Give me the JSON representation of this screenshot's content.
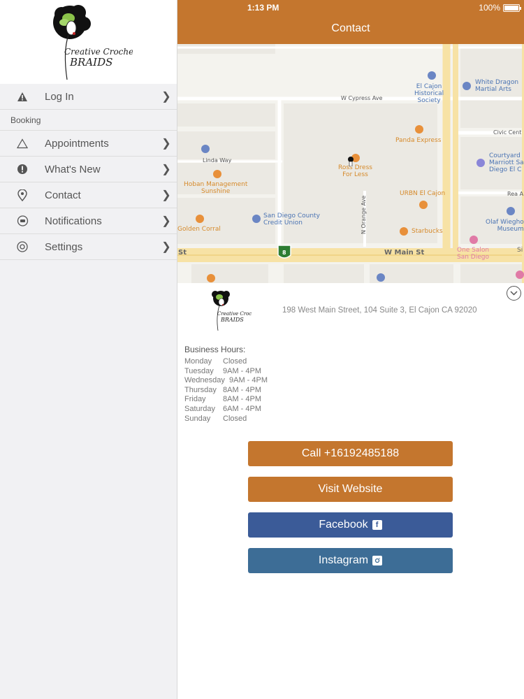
{
  "sidebar": {
    "logo_text_line1": "Creative Crochet",
    "logo_text_line2": "BRAIDS",
    "items": [
      {
        "label": "Log In",
        "icon": "warning-icon"
      },
      {
        "label": "Appointments",
        "icon": "triangle-icon"
      },
      {
        "label": "What's New",
        "icon": "exclamation-icon"
      },
      {
        "label": "Contact",
        "icon": "location-pin-icon"
      },
      {
        "label": "Notifications",
        "icon": "speech-bubble-icon"
      },
      {
        "label": "Settings",
        "icon": "gear-icon"
      }
    ],
    "section_booking": "Booking"
  },
  "status": {
    "time": "1:13 PM",
    "battery": "100%"
  },
  "nav": {
    "title": "Contact"
  },
  "map": {
    "labels": {
      "el_cajon_historical": "El Cajon\nHistorical\nSociety",
      "white_dragon": "White Dragon\nMartial Arts",
      "w_cypress": "W Cypress Ave",
      "civic_center": "Civic Cent",
      "panda": "Panda Express",
      "courtyard": "Courtyard\nMarriott Sa\nDiego El C",
      "linda_way": "Linda Way",
      "ross": "Ross Dress\nFor Less",
      "hoban": "Hoban Management\nSunshine",
      "urbn": "URBN El Cajon",
      "rea": "Rea A",
      "golden_corral": "Golden Corral",
      "sd_credit": "San Diego County\nCredit Union",
      "n_orange": "N Orange Ave",
      "starbucks": "Starbucks",
      "olaf": "Olaf Wiegho\nMuseum",
      "st": "St",
      "w_main": "W Main St",
      "one_salon": "One Salon\nSan Diego",
      "si": "Si",
      "route": "8"
    }
  },
  "card": {
    "address": "198 West Main Street, 104 Suite 3, El Cajon CA 92020",
    "hours_title": "Business Hours:",
    "hours": [
      {
        "day": "Monday",
        "time": "Closed"
      },
      {
        "day": "Tuesday",
        "time": "9AM - 4PM"
      },
      {
        "day": "Wednesday",
        "time": "9AM - 4PM"
      },
      {
        "day": "Thursday",
        "time": "8AM - 4PM"
      },
      {
        "day": "Friday",
        "time": "8AM - 4PM"
      },
      {
        "day": "Saturday",
        "time": "6AM - 4PM"
      },
      {
        "day": "Sunday",
        "time": "Closed"
      }
    ],
    "buttons": {
      "call": "Call +16192485188",
      "website": "Visit Website",
      "facebook": "Facebook",
      "instagram": "Instagram"
    }
  },
  "colors": {
    "brand": "#c4762e",
    "facebook": "#3b5b98",
    "instagram": "#3d6d96"
  }
}
